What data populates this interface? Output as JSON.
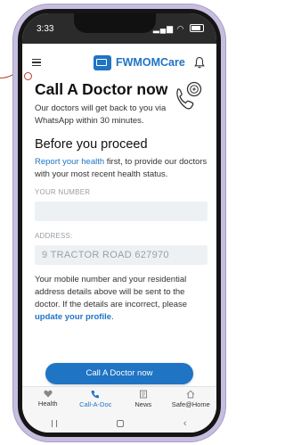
{
  "status_bar": {
    "time": "3:33",
    "signal_icon": "signal-icon",
    "wifi_icon": "wifi-icon",
    "battery_icon": "battery-icon"
  },
  "header": {
    "brand_name": "FWMOMCare",
    "menu_icon": "menu-icon",
    "notification_icon": "bell-icon"
  },
  "main": {
    "title": "Call A Doctor now",
    "intro": "Our doctors will get back to you via WhatsApp within 30 minutes.",
    "phone_icon": "phone-doctor-icon",
    "section_title": "Before you proceed",
    "report_link": "Report your health",
    "report_text": " first, to provide our doctors with your most recent health status.",
    "number_label": "YOUR NUMBER",
    "number_value": "",
    "address_label": "ADDRESS:",
    "address_value": "9 TRACTOR ROAD 627970",
    "notice_text": "Your mobile number and your residential address details above will be sent to the doctor. If the details are incorrect, please ",
    "notice_link": "update your profile",
    "notice_end": ".",
    "cta_label": "Call A Doctor now"
  },
  "tabs": [
    {
      "label": "Health",
      "icon": "heart-icon",
      "active": false
    },
    {
      "label": "Call-A-Doc",
      "icon": "phone-icon",
      "active": true
    },
    {
      "label": "News",
      "icon": "news-icon",
      "active": false
    },
    {
      "label": "Safe@Home",
      "icon": "home-icon",
      "active": false
    }
  ],
  "colors": {
    "accent": "#1f74c4",
    "annotation": "#c0392b",
    "phone_frame": "#c7bedf"
  }
}
